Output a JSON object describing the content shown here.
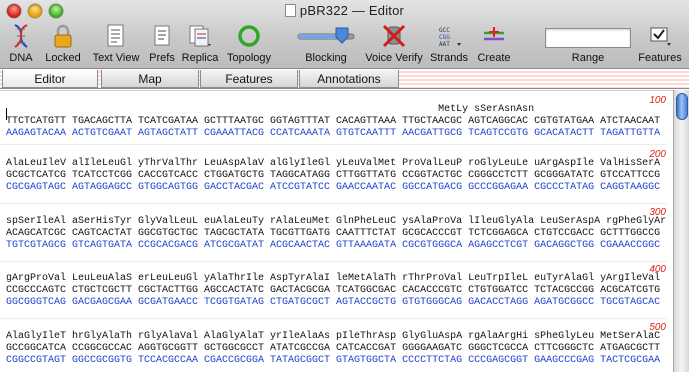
{
  "window": {
    "title": "pBR322 — Editor"
  },
  "toolbar": {
    "items": [
      {
        "label": "DNA",
        "icon": "dna-helix-icon"
      },
      {
        "label": "Locked",
        "icon": "padlock-icon"
      },
      {
        "label": "Text View",
        "icon": "text-view-icon"
      },
      {
        "label": "Prefs",
        "icon": "preferences-icon"
      },
      {
        "label": "Replica",
        "icon": "replica-icon"
      },
      {
        "label": "Topology",
        "icon": "circular-topology-icon"
      },
      {
        "label": "Blocking",
        "icon": "blocking-slider-icon"
      },
      {
        "label": "Voice Verify",
        "icon": "voice-verify-icon"
      },
      {
        "label": "Strands",
        "icon": "strands-icon"
      },
      {
        "label": "Create",
        "icon": "create-icon"
      },
      {
        "label": "Range",
        "icon": "range-field"
      },
      {
        "label": "Features",
        "icon": "features-icon"
      }
    ],
    "range_value": "",
    "blocking_level": 0.72
  },
  "tabs": [
    "Editor",
    "Map",
    "Features",
    "Annotations"
  ],
  "active_tab": "Editor",
  "sequence": {
    "blocks": [
      {
        "aa": "                                                                        MetLy sSerAsnAsn",
        "top": "TTCTCATGTT TGACAGCTTA TCATCGATAA GCTTTAATGC GGTAGTTTAT CACAGTTAAA TTGCTAACGC AGTCAGGCAC CGTGTATGAA ATCTAACAAT",
        "bot": "AAGAGTACAA ACTGTCGAAT AGTAGCTATT CGAAATTACG CCATCAAATA GTGTCAATTT AACGATTGCG TCAGTCCGTG GCACATACTT TAGATTGTTA",
        "num": "100"
      },
      {
        "aa": "AlaLeuIleV alIleLeuGl yThrValThr LeuAspAlaV alGlyIleGl yLeuValMet ProValLeuP roGlyLeuLe uArgAspIle ValHisSerA",
        "top": "GCGCTCATCG TCATCCTCGG CACCGTCACC CTGGATGCTG TAGGCATAGG CTTGGTTATG CCGGTACTGC CGGGCCTCTT GCGGGATATC GTCCATTCCG",
        "bot": "CGCGAGTAGC AGTAGGAGCC GTGGCAGTGG GACCTACGAC ATCCGTATCC GAACCAATAC GGCCATGACG GCCCGGAGAA CGCCCTATAG CAGGTAAGGC",
        "num": "200"
      },
      {
        "aa": "spSerIleAl aSerHisTyr GlyValLeuL euAlaLeuTy rAlaLeuMet GlnPheLeuC ysAlaProVa lIleuGlyAla LeuSerAspA rgPheGlyAr",
        "top": "ACAGCATCGC CAGTCACTAT GGCGTGCTGC TAGCGCTATA TGCGTTGATG CAATTTCTAT GCGCACCCGT TCTCGGAGCA CTGTCCGACC GCTTTGGCCG",
        "bot": "TGTCGTAGCG GTCAGTGATA CCGCACGACG ATCGCGATAT ACGCAACTAC GTTAAAGATA CGCGTGGGCA AGAGCCTCGT GACAGGCTGG CGAAACCGGC",
        "num": "300"
      },
      {
        "aa": "gArgProVal LeuLeuAlaS erLeuLeuGl yAlaThrIle AspTyrAlaI leMetAlaTh rThrProVal LeuTrpIleL euTyrAlaGl yArgIleVal",
        "top": "CCGCCCAGTC CTGCTCGCTT CGCTACTTGG AGCCACTATC GACTACGCGA TCATGGCGAC CACACCCGTC CTGTGGATCC TCTACGCCGG ACGCATCGTG",
        "bot": "GGCGGGTCAG GACGAGCGAA GCGATGAACC TCGGTGATAG CTGATGCGCT AGTACCGCTG GTGTGGGCAG GACACCTAGG AGATGCGGCC TGCGTAGCAC",
        "num": "400"
      },
      {
        "aa": "AlaGlyIleT hrGlyAlaTh rGlyAlaVal AlaGlyAlaT yrIleAlaAs pIleThrAsp GlyGluAspA rgAlaArgHi sPheGlyLeu MetSerAlaC",
        "top": "GCCGGCATCA CCGGCGCCAC AGGTGCGGTT GCTGGCGCCT ATATCGCCGA CATCACCGAT GGGGAAGATC GGGCTCGCCA CTTCGGGCTC ATGAGCGCTT",
        "bot": "CGGCCGTAGT GGCCGCGGTG TCCACGCCAA CGACCGCGGA TATAGCGGCT GTAGTGGCTA CCCCTTCTAG CCCGAGCGGT GAAGCCCGAG TACTCGCGAA",
        "num": "500"
      }
    ]
  }
}
